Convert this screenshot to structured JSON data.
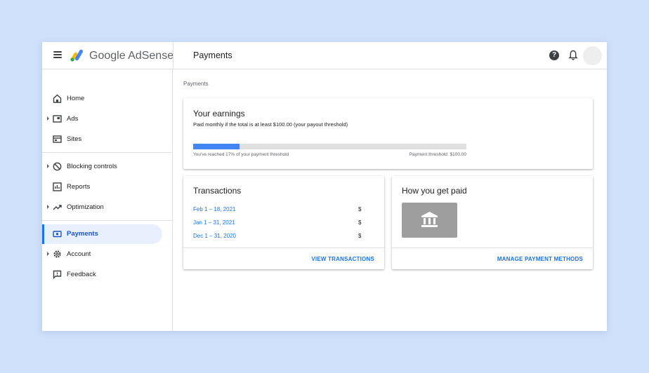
{
  "app": {
    "brand": "Google AdSense",
    "page_title": "Payments"
  },
  "sidebar": {
    "items": [
      {
        "label": "Home",
        "icon": "home-icon",
        "expandable": false
      },
      {
        "label": "Ads",
        "icon": "ads-icon",
        "expandable": true
      },
      {
        "label": "Sites",
        "icon": "sites-icon",
        "expandable": false
      },
      {
        "label": "Blocking controls",
        "icon": "block-icon",
        "expandable": true
      },
      {
        "label": "Reports",
        "icon": "reports-icon",
        "expandable": false
      },
      {
        "label": "Optimization",
        "icon": "trending-icon",
        "expandable": true
      },
      {
        "label": "Payments",
        "icon": "payments-icon",
        "expandable": false,
        "active": true
      },
      {
        "label": "Account",
        "icon": "gear-icon",
        "expandable": true
      },
      {
        "label": "Feedback",
        "icon": "feedback-icon",
        "expandable": false
      }
    ]
  },
  "breadcrumb": "Payments",
  "earnings": {
    "title": "Your earnings",
    "subtitle": "Paid monthly if the total is at least $100.00 (your payout threshold)",
    "progress_fraction": 0.17,
    "reached_text": "You've reached 17% of your payment threshold",
    "threshold_text": "Payment threshold: $100.00"
  },
  "transactions": {
    "title": "Transactions",
    "rows": [
      {
        "period": "Feb 1 – 18, 2021",
        "amount": "$"
      },
      {
        "period": "Jan 1 – 31, 2021",
        "amount": "$"
      },
      {
        "period": "Dec 1 – 31, 2020",
        "amount": "$"
      }
    ],
    "action": "VIEW TRANSACTIONS"
  },
  "how_paid": {
    "title": "How you get paid",
    "icon": "bank-icon",
    "action": "MANAGE PAYMENT METHODS"
  },
  "colors": {
    "background": "#cfe0fb",
    "accent": "#1a73e8",
    "progress": "#4285f4",
    "active_nav_bg": "#e8f0fe"
  }
}
